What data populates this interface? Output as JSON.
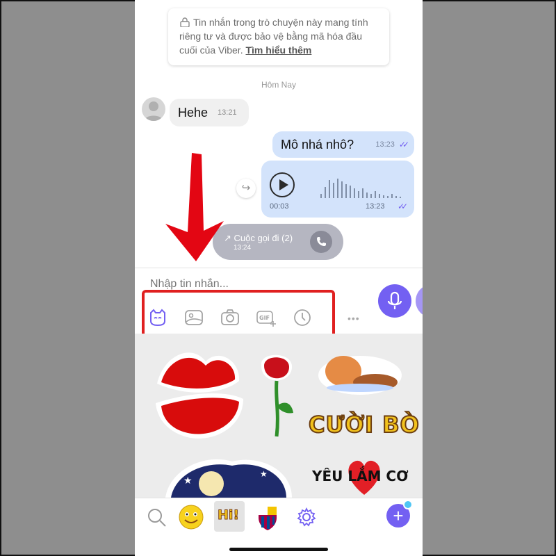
{
  "notice": {
    "text": "Tin nhắn trong trò chuyện này mang tính riêng tư và được bảo vệ bằng mã hóa đầu cuối của Viber.",
    "link": "Tìm hiểu thêm"
  },
  "day_separator": "Hôm Nay",
  "messages": {
    "incoming": {
      "text": "Hehe",
      "time": "13:21"
    },
    "outgoing": {
      "text": "Mô nhá nhô?",
      "time": "13:23"
    },
    "voice": {
      "duration": "00:03",
      "time": "13:23"
    },
    "call": {
      "label": "↗ Cuộc gọi đi (2)",
      "time": "13:24"
    }
  },
  "composer": {
    "placeholder": "Nhập tin nhắn...",
    "tools": [
      "sticker-icon",
      "gallery-icon",
      "camera-icon",
      "gif-icon",
      "clock-icon"
    ],
    "more": "•••"
  },
  "stickers": {
    "cuoi_bo": "CƯỜI BÒ",
    "yeu_lam_co": "YÊU LẮM CƠ"
  },
  "bottom_bar": {
    "hi_label": "Hi!"
  },
  "colors": {
    "accent": "#7360f2",
    "highlight": "#e02020",
    "bubble_out": "#d3e3fb"
  }
}
